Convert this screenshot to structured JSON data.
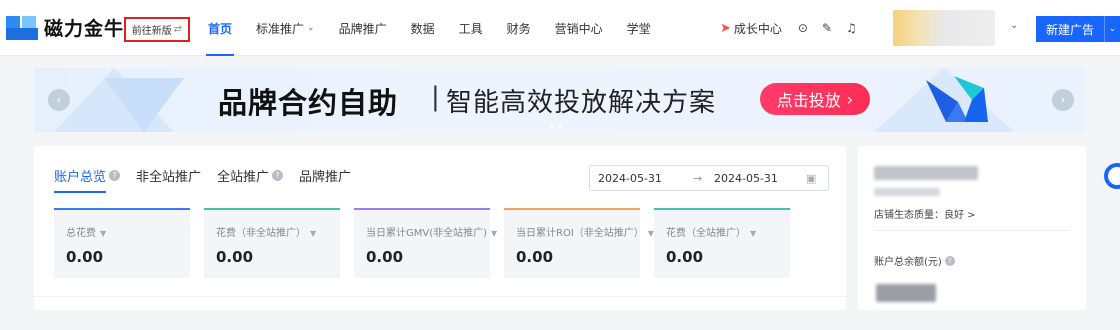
{
  "header": {
    "logo_text": "磁力金牛",
    "new_version_label": "前往新版",
    "nav": [
      {
        "label": "首页",
        "active": true,
        "has_dropdown": false
      },
      {
        "label": "标准推广",
        "active": false,
        "has_dropdown": true
      },
      {
        "label": "品牌推广",
        "active": false,
        "has_dropdown": false
      },
      {
        "label": "数据",
        "active": false,
        "has_dropdown": false
      },
      {
        "label": "工具",
        "active": false,
        "has_dropdown": false
      },
      {
        "label": "财务",
        "active": false,
        "has_dropdown": false
      },
      {
        "label": "营销中心",
        "active": false,
        "has_dropdown": false
      },
      {
        "label": "学堂",
        "active": false,
        "has_dropdown": false
      }
    ],
    "growth_center_label": "成长中心",
    "new_ad_label": "新建广告"
  },
  "banner": {
    "title": "品牌合约自助",
    "separator": "|",
    "subtitle": "智能高效投放解决方案",
    "cta_label": "点击投放"
  },
  "overview": {
    "tabs": [
      {
        "label": "账户总览",
        "active": true,
        "help": true
      },
      {
        "label": "非全站推广",
        "active": false,
        "help": false
      },
      {
        "label": "全站推广",
        "active": false,
        "help": true
      },
      {
        "label": "品牌推广",
        "active": false,
        "help": false
      }
    ],
    "date_start": "2024-05-31",
    "date_arrow": "→",
    "date_end": "2024-05-31",
    "metrics": [
      {
        "label": "总花费",
        "value": "0.00",
        "color": "#3a78f2"
      },
      {
        "label": "花费（非全站推广）",
        "value": "0.00",
        "color": "#40c4a0"
      },
      {
        "label": "当日累计GMV(非全站推广)",
        "value": "0.00",
        "color": "#9b7cf0"
      },
      {
        "label": "当日累计ROI（非全站推广）",
        "value": "0.00",
        "color": "#f2a45a"
      },
      {
        "label": "花费（全站推广）",
        "value": "0.00",
        "color": "#3fc1b5"
      }
    ]
  },
  "side": {
    "shop_quality_label": "店铺生态质量：良好 >",
    "balance_label": "账户总余额(元)"
  },
  "colors": {
    "accent": "#1966ff",
    "cta": "#ff2d55",
    "highlight_border": "#e02020"
  }
}
